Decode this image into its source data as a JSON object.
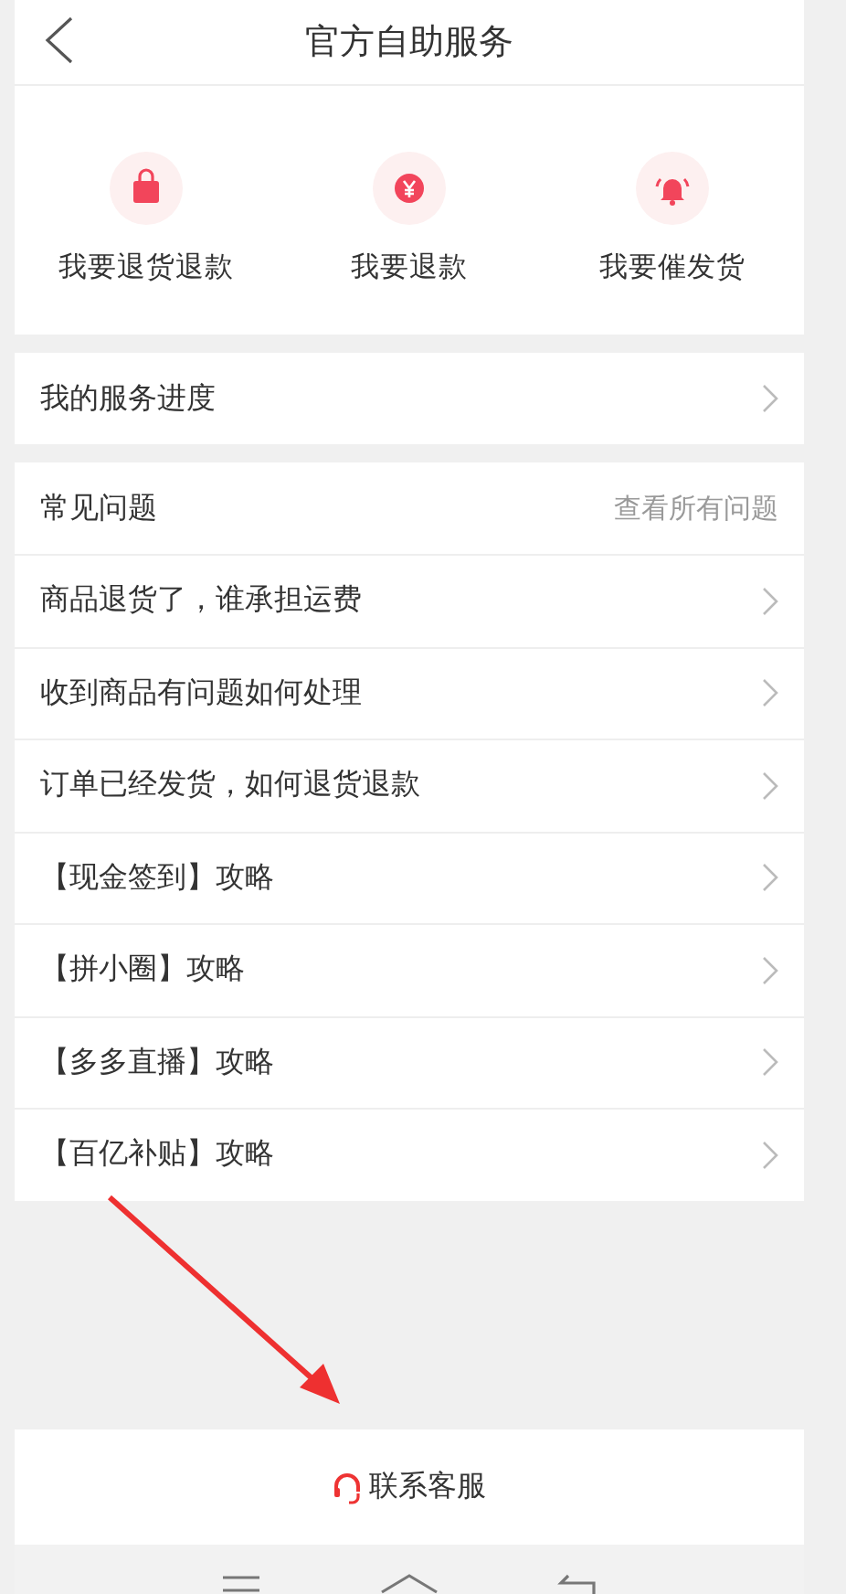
{
  "header": {
    "title": "官方自助服务"
  },
  "shortcuts": [
    {
      "label": "我要退货退款",
      "kind": "bag"
    },
    {
      "label": "我要退款",
      "kind": "yen"
    },
    {
      "label": "我要催发货",
      "kind": "bell"
    }
  ],
  "progress": {
    "label": "我的服务进度"
  },
  "faq": {
    "title": "常见问题",
    "more": "查看所有问题",
    "items": [
      "商品退货了，谁承担运费",
      "收到商品有问题如何处理",
      "订单已经发货，如何退货退款",
      "【现金签到】攻略",
      "【拼小圈】攻略",
      "【多多直播】攻略",
      "【百亿补贴】攻略"
    ]
  },
  "contact": {
    "label": "联系客服"
  }
}
